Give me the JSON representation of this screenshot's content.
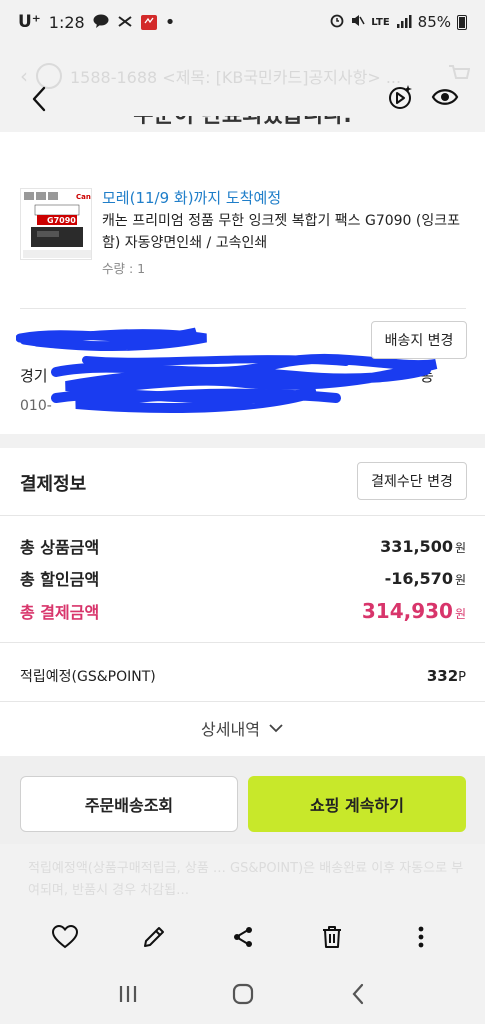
{
  "status_bar": {
    "carrier": "U⁺",
    "time": "1:28",
    "battery": "85%",
    "network": "LTE"
  },
  "viewer": {
    "ghost_text": "1588-1688  <제목: [KB국민카드]공지사항> ..."
  },
  "order": {
    "title": "주문이 완료되었습니다.",
    "product": {
      "eta": "모레(11/9 화)까지 도착예정",
      "name": "캐논 프리미엄 정품 무한 잉크젯 복합기 팩스 G7090 (잉크포함) 자동양면인쇄 / 고속인쇄",
      "qty": "수량 : 1",
      "thumb_brand": "Canon",
      "thumb_model": "G7090"
    },
    "address": {
      "line1_tail": "l)",
      "line2_head": "경기",
      "line2_tail": "동",
      "phone_head": "010-",
      "change_button": "배송지 변경"
    }
  },
  "payment": {
    "title": "결제정보",
    "change_method_button": "결제수단 변경",
    "rows": [
      {
        "label": "총 상품금액",
        "value": "331,500",
        "unit": "원"
      },
      {
        "label": "총 할인금액",
        "value": "-16,570",
        "unit": "원"
      },
      {
        "label": "총 결제금액",
        "value": "314,930",
        "unit": "원"
      }
    ],
    "points": {
      "label": "적립예정(GS&POINT)",
      "value": "332",
      "unit": "P"
    },
    "details_toggle": "상세내역"
  },
  "buttons": {
    "order_tracking": "주문배송조회",
    "continue_shopping": "쇼핑 계속하기"
  },
  "faded_note": "적립예정액(상품구매적립금, 상품 … GS&POINT)은 배송완료 이후 자동으로 부여되며, 반품시 경우 차감됩…",
  "colors": {
    "accent_blue": "#1f7ec9",
    "total_pink": "#d8356b",
    "shop_green": "#c8e82a",
    "scribble": "#1a3cf0"
  }
}
